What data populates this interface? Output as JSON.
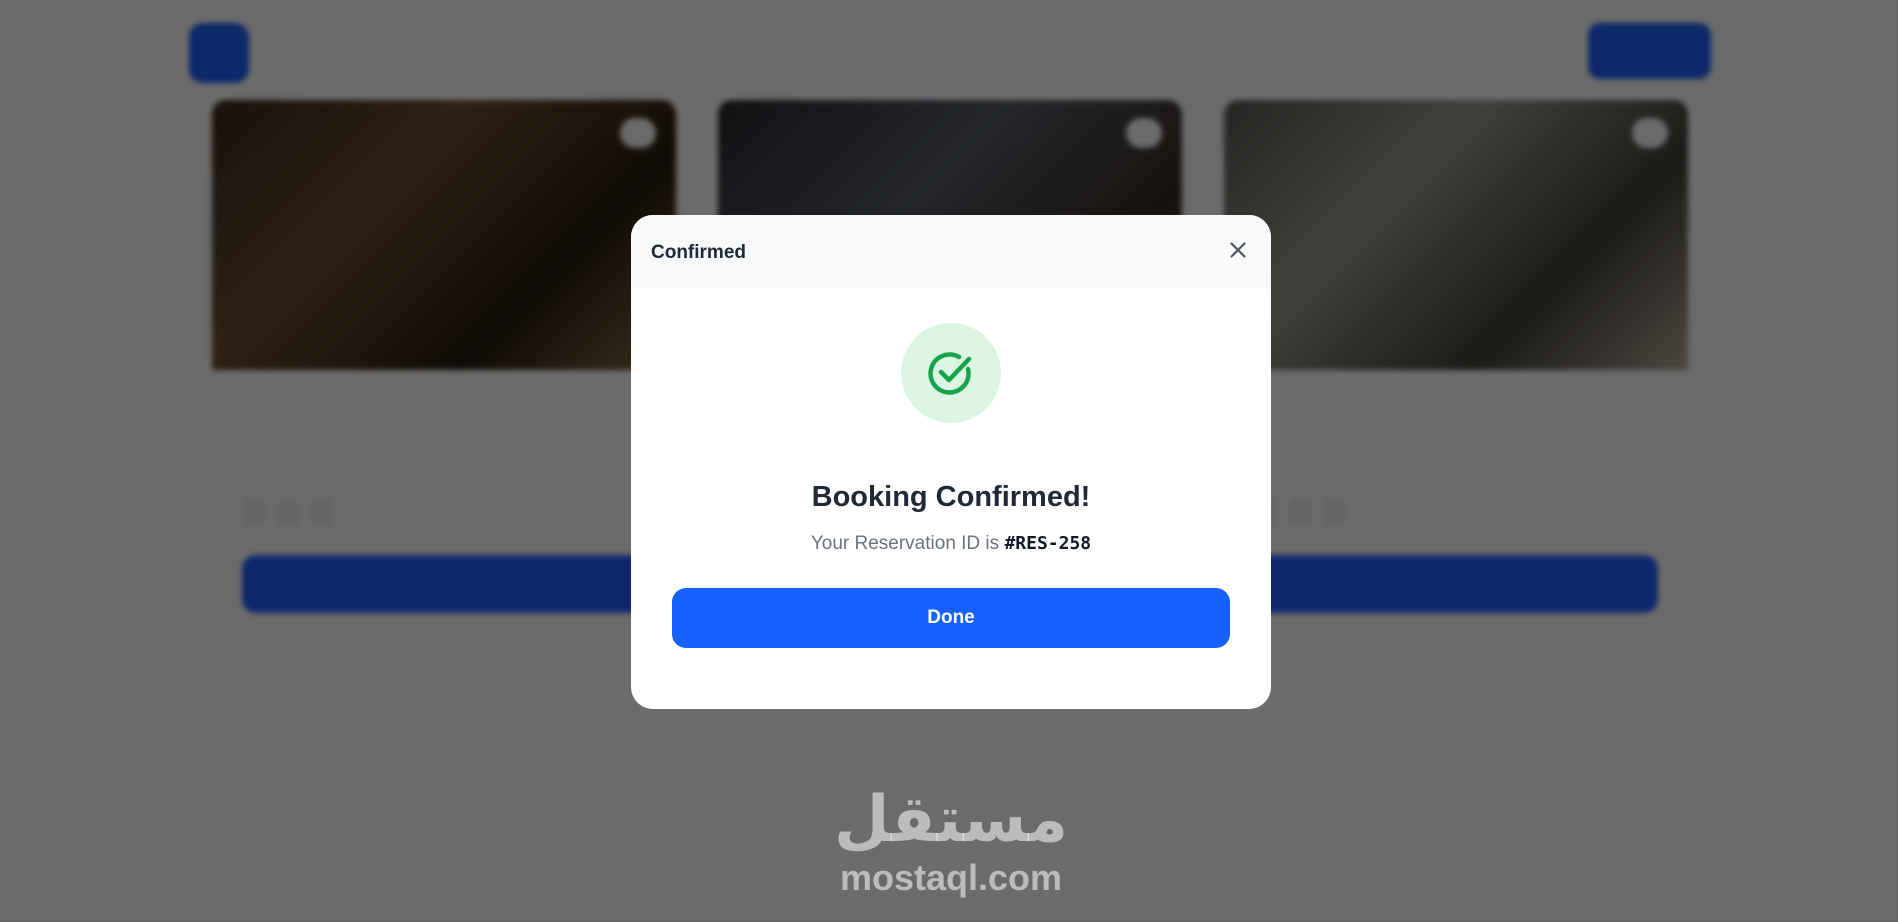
{
  "background": {
    "header": {
      "brand_name": "",
      "brand_subtitle": "",
      "nav_link": "",
      "nav_button": ""
    },
    "rooms": [
      {
        "title": "",
        "description": "",
        "price": "",
        "chips": [
          "",
          "",
          ""
        ],
        "button": ""
      },
      {
        "title": "",
        "description": "",
        "price": "",
        "chips": [
          "",
          "",
          ""
        ],
        "button": ""
      },
      {
        "title": "",
        "description": "",
        "price": "",
        "chips": [
          "",
          "",
          ""
        ],
        "button": ""
      }
    ]
  },
  "modal": {
    "title": "Confirmed",
    "heading": "Booking Confirmed!",
    "reservation_prefix": "Your Reservation ID is",
    "reservation_id": "#RES-258",
    "done_label": "Done",
    "close_icon": "close-icon",
    "status_icon": "check-circle-icon",
    "colors": {
      "primary": "#1762ff",
      "success": "#16a34a",
      "success_bg": "#dcf5e3"
    }
  },
  "watermark": {
    "arabic": "مستقل",
    "latin": "mostaql.com"
  }
}
